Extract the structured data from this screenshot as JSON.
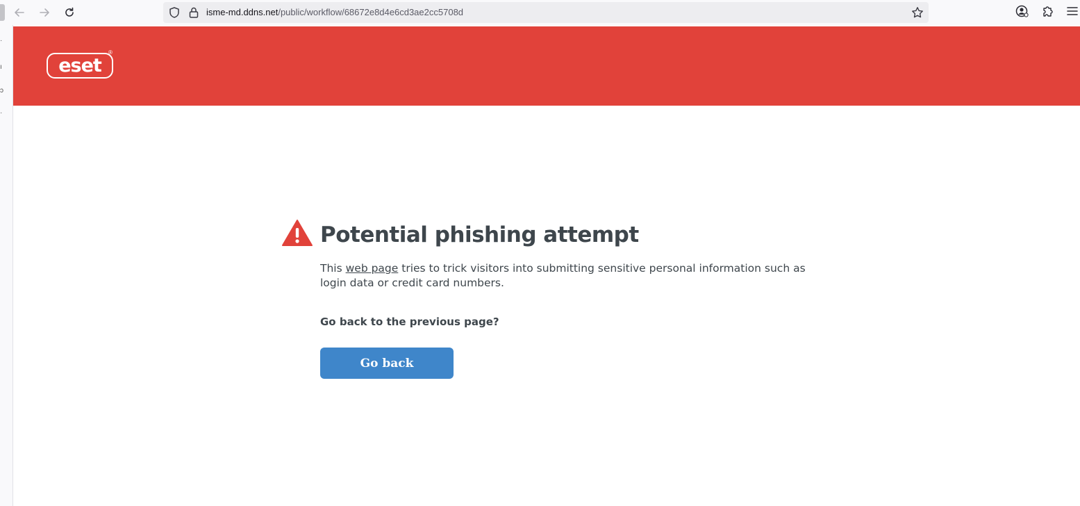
{
  "browser": {
    "url_host": "isme-md.ddns.net",
    "url_path": "/public/workflow/68672e8d4e6cd3ae2cc5708d",
    "icons": {
      "back": "arrow-left-icon",
      "forward": "arrow-right-icon",
      "reload": "reload-icon",
      "tracking": "shield-icon",
      "lock": "lock-icon",
      "bookmark": "star-icon",
      "account": "account-icon",
      "extensions": "puzzle-icon",
      "menu": "hamburger-menu-icon"
    }
  },
  "header": {
    "brand_color": "#e1423a",
    "logo_text": "eset",
    "logo_reg": "®"
  },
  "warning": {
    "icon": "warning-triangle-icon",
    "title": "Potential phishing attempt",
    "desc_before": "This ",
    "desc_link": "web page",
    "desc_after": " tries to trick visitors into submitting sensitive personal information such as login data or credit card numbers.",
    "question": "Go back to the previous page?",
    "button_label": "Go back",
    "button_color": "#3f86ca"
  }
}
